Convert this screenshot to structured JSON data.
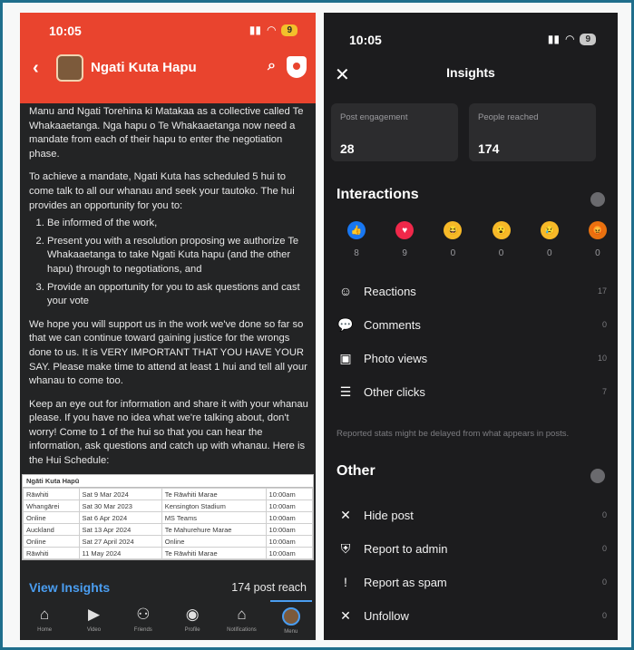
{
  "left": {
    "status_time": "10:05",
    "battery": "9",
    "group_name": "Ngati Kuta Hapu",
    "post_paragraphs": [
      "Manu and Ngati Torehina ki Matakaa as a collective called Te Whakaaetanga. Nga hapu o Te Whakaaetanga now need a mandate from each of their hapu to enter the negotiation phase.",
      "To achieve a mandate, Ngati Kuta has scheduled 5 hui to come talk to all our whanau and seek your tautoko. The hui provides an opportunity for you to:"
    ],
    "post_list": [
      "Be informed of the work,",
      "Present you with a resolution proposing we authorize Te Whakaaetanga to take Ngati Kuta hapu (and the other hapu) through to negotiations, and",
      "Provide an opportunity for you to ask questions and cast your vote"
    ],
    "post_paragraphs_after": [
      "We hope you will support us in the work we've done so far so that we can continue toward gaining justice for the wrongs done to us. It is VERY IMPORTANT THAT YOU HAVE YOUR SAY. Please make time to attend at least 1 hui and tell all your whanau to come too.",
      "Keep an eye out for information and share it with your whanau please. If you have no idea what we're talking about, don't worry! Come to 1 of the hui so that you can hear the information, ask questions and catch up with whanau. Here is the Hui Schedule:"
    ],
    "schedule_title": "Ngāti Kuta Hapū",
    "schedule_rows": [
      [
        "Rāwhiti",
        "Sat 9 Mar 2024",
        "Te Rāwhiti Marae",
        "10:00am"
      ],
      [
        "Whangārei",
        "Sat 30 Mar 2023",
        "Kensington Stadium",
        "10:00am"
      ],
      [
        "Online",
        "Sat 6 Apr 2024",
        "MS Teams",
        "10:00am"
      ],
      [
        "Auckland",
        "Sat 13 Apr 2024",
        "Te Mahurehure Marae",
        "10:00am"
      ],
      [
        "Online",
        "Sat 27 April 2024",
        "Online",
        "10:00am"
      ],
      [
        "Rāwhiti",
        "11 May 2024",
        "Te Rāwhiti Marae",
        "10:00am"
      ]
    ],
    "view_insights_label": "View Insights",
    "post_reach": "174 post reach",
    "tabs": [
      {
        "icon": "home-icon",
        "label": "Home",
        "glyph": "⌂"
      },
      {
        "icon": "video-icon",
        "label": "Video",
        "glyph": "▶"
      },
      {
        "icon": "friends-icon",
        "label": "Friends",
        "glyph": "⚇"
      },
      {
        "icon": "profile-icon",
        "label": "Profile",
        "glyph": "◉"
      },
      {
        "icon": "bell-icon",
        "label": "Notifications",
        "glyph": "♫"
      },
      {
        "icon": "menu-avatar-icon",
        "label": "Menu",
        "glyph": ""
      }
    ]
  },
  "right": {
    "status_time": "10:05",
    "battery": "9",
    "title": "Insights",
    "cards": [
      {
        "label": "Post engagement",
        "value": "28"
      },
      {
        "label": "People reached",
        "value": "174"
      }
    ],
    "interactions_heading": "Interactions",
    "reactions": [
      {
        "icon": "like-icon",
        "glyph": "👍",
        "color": "#1877f2",
        "count": "8"
      },
      {
        "icon": "love-icon",
        "glyph": "♥",
        "color": "#f0284a",
        "count": "9"
      },
      {
        "icon": "haha-icon",
        "glyph": "😆",
        "color": "#f7b928",
        "count": "0"
      },
      {
        "icon": "wow-icon",
        "glyph": "😮",
        "color": "#f7b928",
        "count": "0"
      },
      {
        "icon": "sad-icon",
        "glyph": "😢",
        "color": "#f7b928",
        "count": "0"
      },
      {
        "icon": "angry-icon",
        "glyph": "😡",
        "color": "#e9710f",
        "count": "0"
      }
    ],
    "interaction_rows": [
      {
        "icon": "smiley-icon",
        "glyph": "☺",
        "label": "Reactions",
        "value": "17"
      },
      {
        "icon": "comment-icon",
        "glyph": "💬",
        "label": "Comments",
        "value": "0"
      },
      {
        "icon": "photo-icon",
        "glyph": "▣",
        "label": "Photo views",
        "value": "10"
      },
      {
        "icon": "clicks-icon",
        "glyph": "☰",
        "label": "Other clicks",
        "value": "7"
      }
    ],
    "note": "Reported stats might be delayed from what appears in posts.",
    "other_heading": "Other",
    "other_rows": [
      {
        "icon": "hide-icon",
        "glyph": "✕",
        "label": "Hide post",
        "value": "0"
      },
      {
        "icon": "shield-icon",
        "glyph": "⛨",
        "label": "Report to admin",
        "value": "0"
      },
      {
        "icon": "spam-icon",
        "glyph": "!",
        "label": "Report as spam",
        "value": "0"
      },
      {
        "icon": "unfollow-icon",
        "glyph": "✕",
        "label": "Unfollow",
        "value": "0"
      }
    ]
  }
}
